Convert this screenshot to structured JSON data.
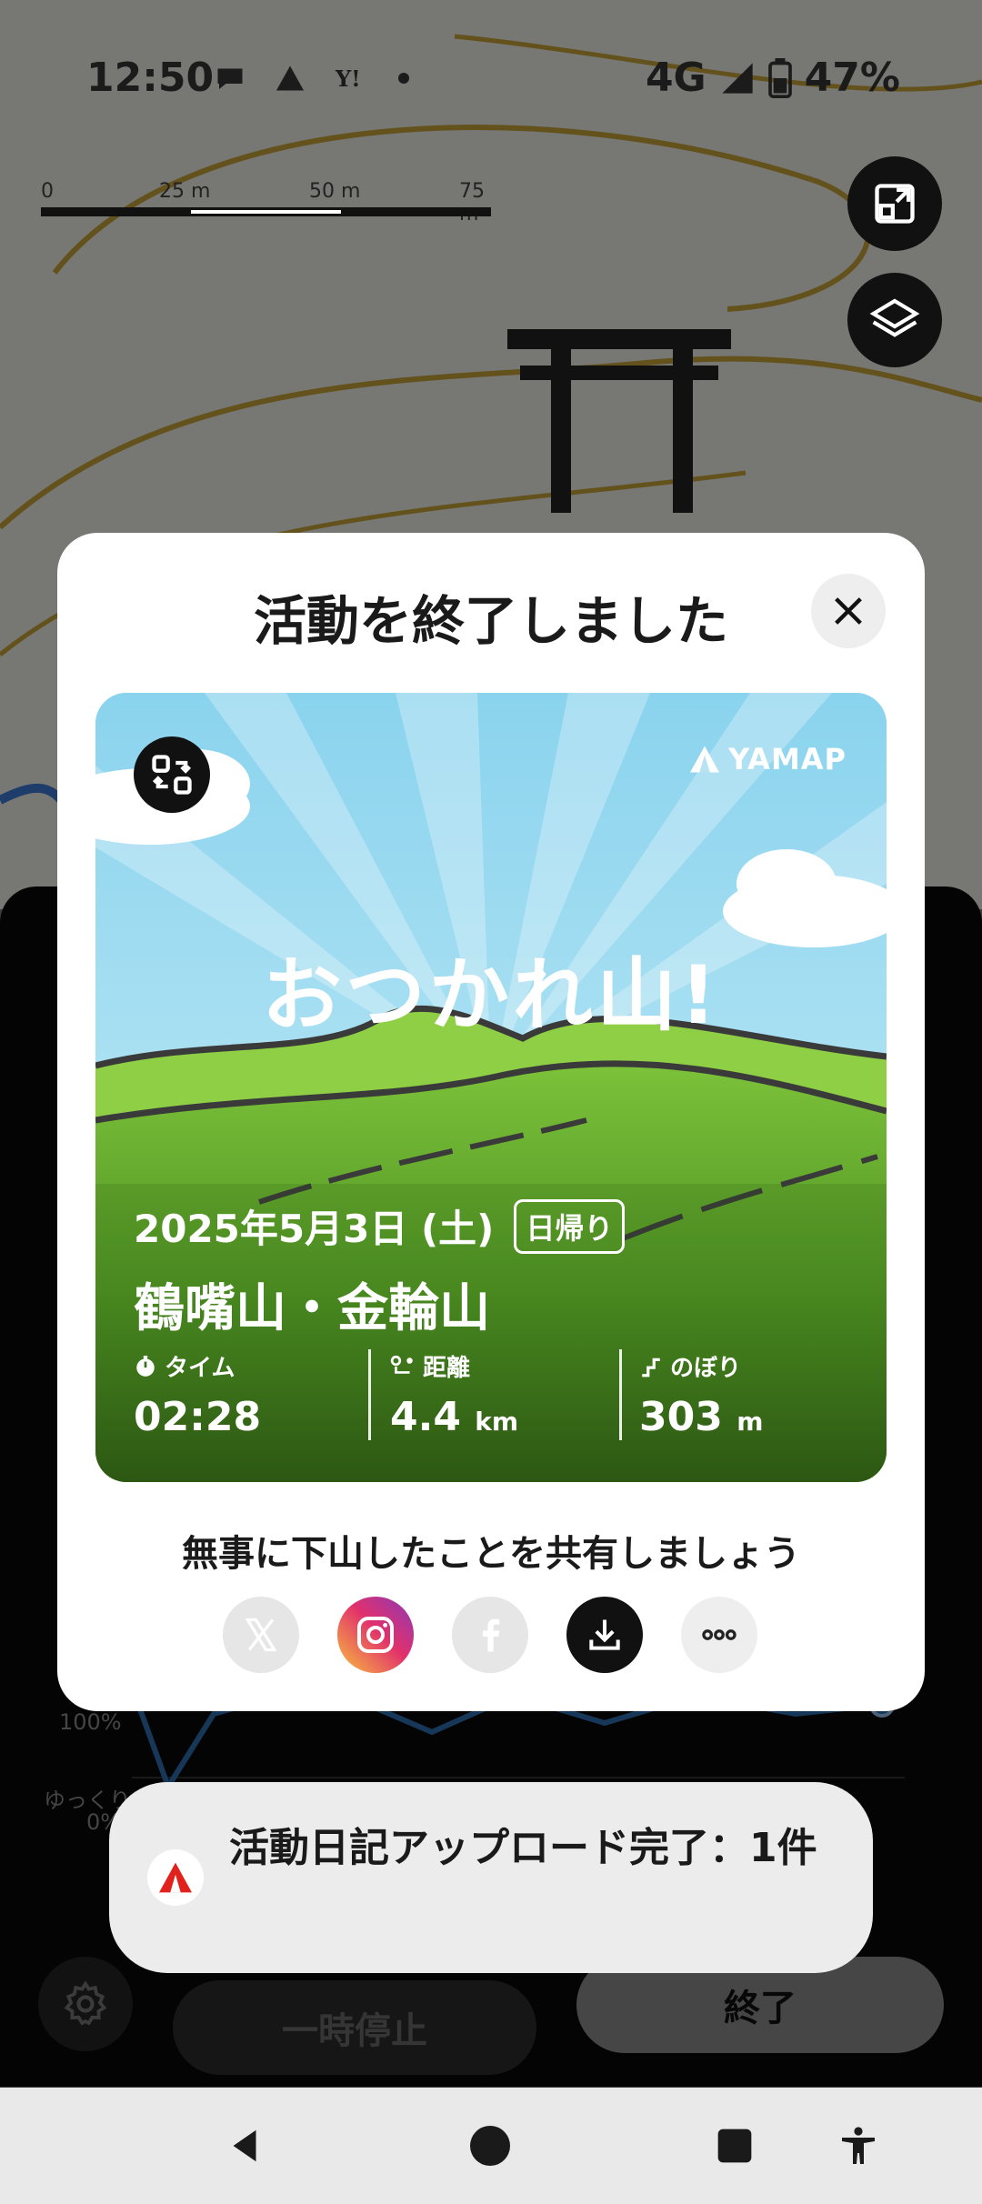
{
  "status_bar": {
    "time": "12:50",
    "network": "4G",
    "battery": "47%"
  },
  "map": {
    "scale_labels": [
      "0",
      "25 m",
      "50 m",
      "75 m"
    ],
    "buttons": [
      "expand-map-icon",
      "layers-icon"
    ]
  },
  "modal": {
    "title": "活動を終了しました",
    "card": {
      "brand": "YAMAP",
      "headline": "おつかれ山!",
      "date": "2025年5月3日 (土)",
      "trip_badge": "日帰り",
      "mountain": "鶴嘴山・金輪山",
      "stats": [
        {
          "label": "タイム",
          "value": "02:28",
          "unit": ""
        },
        {
          "label": "距離",
          "value": "4.4",
          "unit": "km"
        },
        {
          "label": "のぼり",
          "value": "303",
          "unit": "m"
        }
      ]
    },
    "share_prompt": "無事に下山したことを共有しましょう",
    "share_buttons": [
      "x-icon",
      "instagram-icon",
      "facebook-icon",
      "download-icon",
      "more-icon"
    ]
  },
  "tracking_panel": {
    "chart_labels": [
      "100%",
      "ゆっくり",
      "0%"
    ],
    "pause_label": "一時停止",
    "end_label": "終了"
  },
  "toast": {
    "message": "活動日記アップロード完了：1件"
  },
  "colors": {
    "accent_red": "#e0211c",
    "instagram_gradient": [
      "#f9c13c",
      "#e1306c",
      "#8a3ab9"
    ],
    "card_sky": "#8fd7f0",
    "card_green": "#5ea82a"
  }
}
